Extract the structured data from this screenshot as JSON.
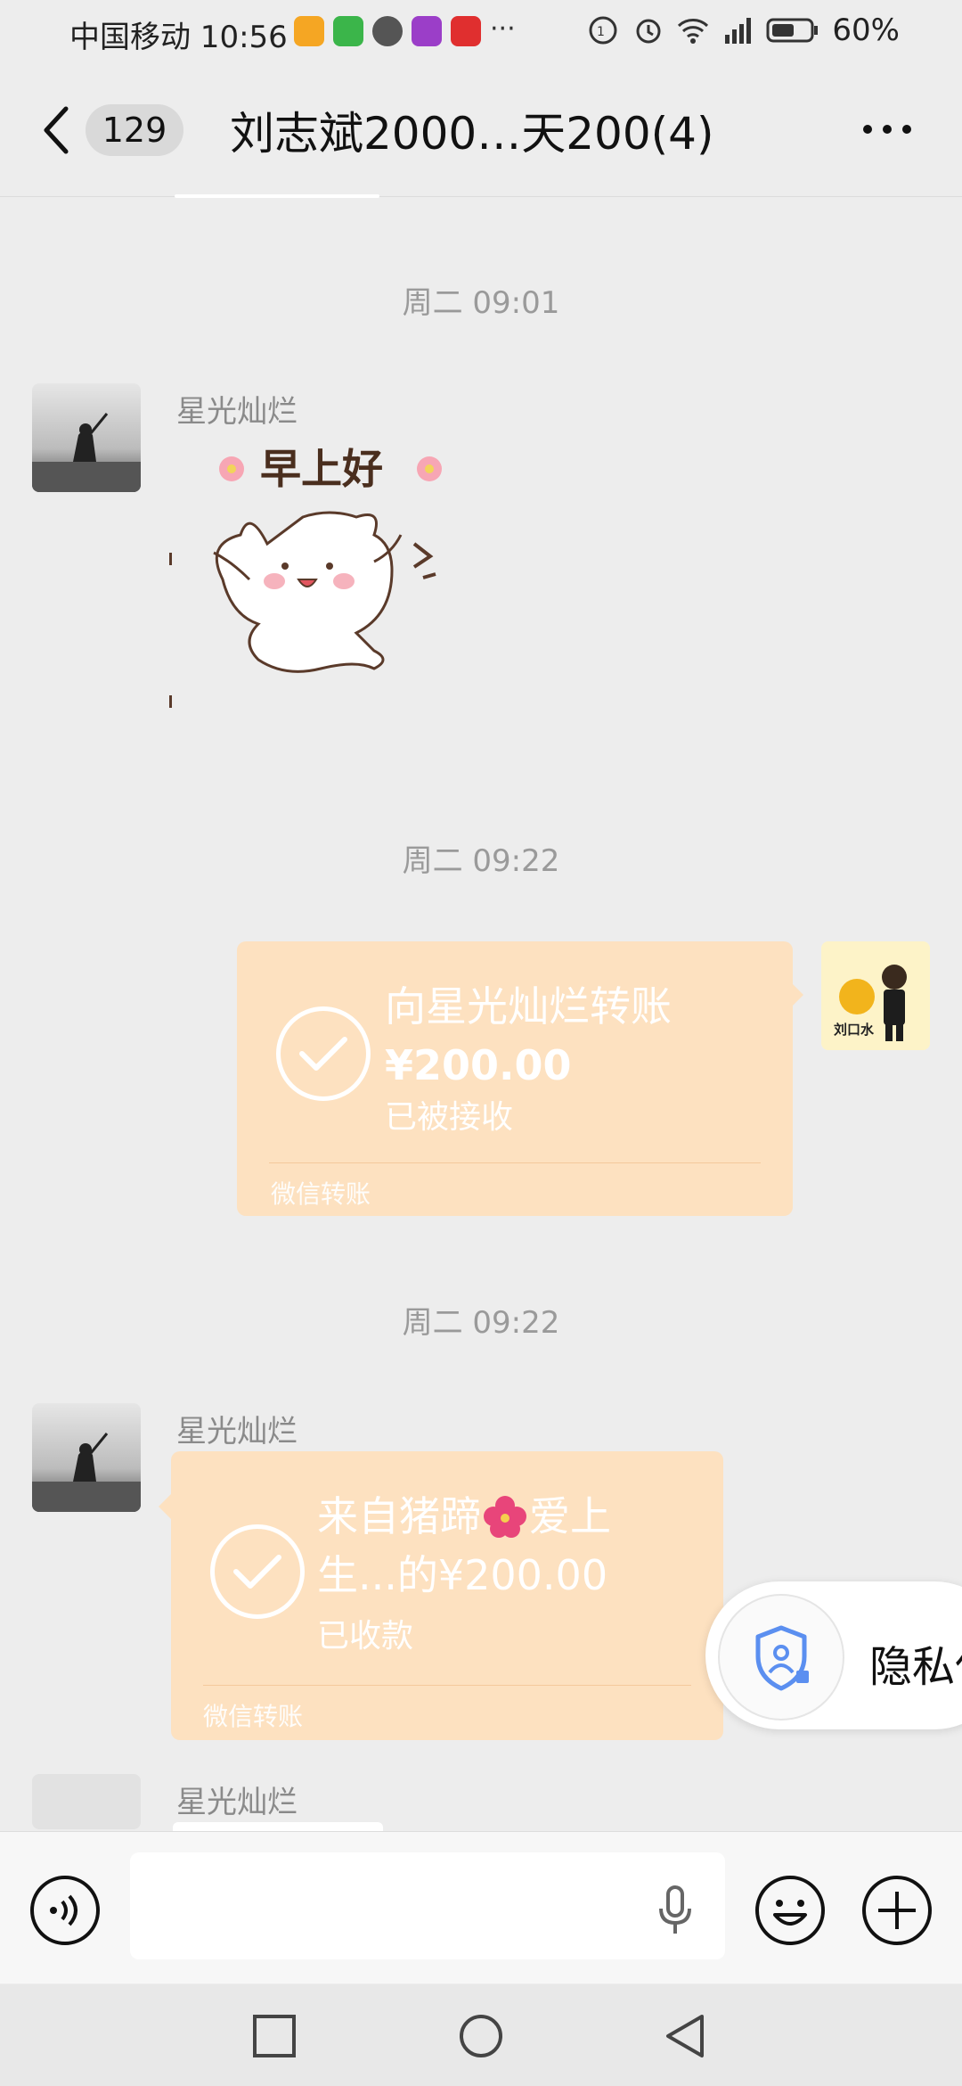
{
  "status_bar": {
    "carrier_time": "中国移动 10:56",
    "more_indicator": "···",
    "battery": "60%"
  },
  "header": {
    "unread_count": "129",
    "title": "刘志斌2000…天200(4)"
  },
  "messages": [
    {
      "type": "timestamp",
      "text": "周二 09:01"
    },
    {
      "type": "sticker",
      "sender": "星光灿烂",
      "sticker_text": "早上好"
    },
    {
      "type": "timestamp",
      "text": "周二 09:22"
    },
    {
      "type": "transfer_out",
      "title": "向星光灿烂转账",
      "amount": "¥200.00",
      "status": "已被接收",
      "footer": "微信转账",
      "self_avatar_text": "刘口水"
    },
    {
      "type": "timestamp",
      "text": "周二 09:22"
    },
    {
      "type": "transfer_in",
      "sender": "星光灿烂",
      "title_line1": "来自猪蹄",
      "title_line1_end": "爱上",
      "title_line2": "生...的¥200.00",
      "status": "已收款",
      "footer": "微信转账"
    },
    {
      "type": "partial",
      "sender": "星光灿烂"
    }
  ],
  "privacy_popup": {
    "label": "隐私保"
  },
  "colors": {
    "bg": "#ededed",
    "transfer": "#fde1c0",
    "text_muted": "#9a9a9a"
  },
  "icons": [
    "back-icon",
    "more-icon",
    "check-circle-icon",
    "shield-user-icon",
    "voice-icon",
    "mic-icon",
    "emoji-icon",
    "plus-icon"
  ]
}
